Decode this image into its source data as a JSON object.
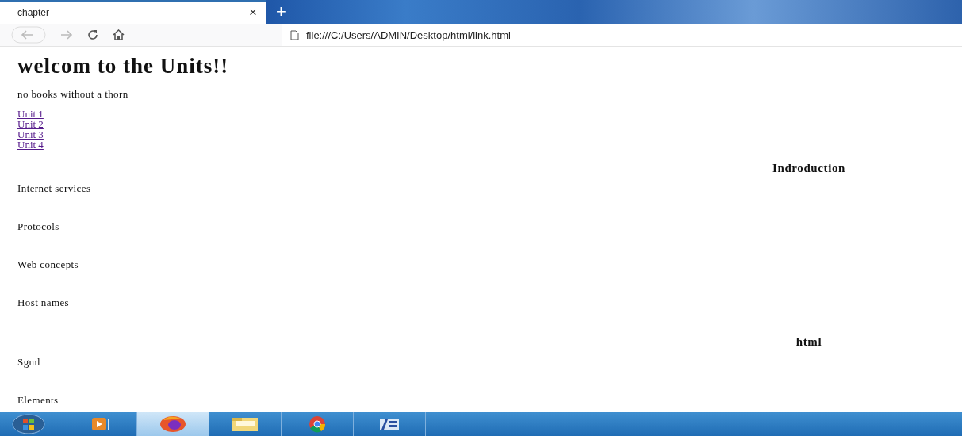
{
  "browser": {
    "tab": {
      "title": "chapter",
      "close": "×"
    },
    "new_tab": "+",
    "address": "file:///C:/Users/ADMIN/Desktop/html/link.html"
  },
  "page": {
    "title": "welcom to the Units!!",
    "tagline": "no books without a thorn",
    "links": [
      "Unit 1",
      "Unit 2",
      "Unit 3",
      "Unit 4"
    ],
    "sections": [
      {
        "kind": "heading",
        "text": "Indroduction"
      },
      {
        "kind": "item",
        "text": "Internet services"
      },
      {
        "kind": "item",
        "text": "Protocols"
      },
      {
        "kind": "item",
        "text": "Web concepts"
      },
      {
        "kind": "item",
        "text": "Host names"
      },
      {
        "kind": "heading",
        "text": "html"
      },
      {
        "kind": "item",
        "text": "Sgml"
      },
      {
        "kind": "item",
        "text": "Elements"
      }
    ]
  },
  "taskbar": {
    "items": [
      {
        "kind": "media",
        "selected": false
      },
      {
        "kind": "firefox",
        "selected": true
      },
      {
        "kind": "folder",
        "selected": false
      },
      {
        "kind": "chrome",
        "selected": false
      },
      {
        "kind": "app",
        "selected": false
      }
    ]
  }
}
